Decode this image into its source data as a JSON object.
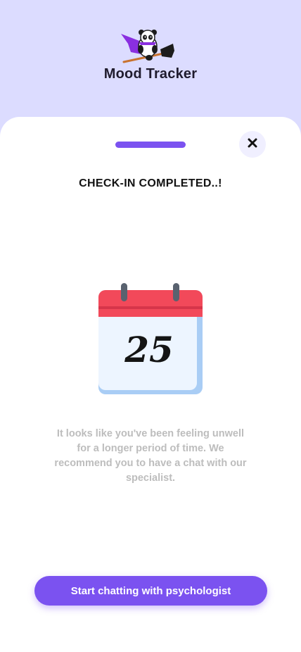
{
  "header": {
    "app_name": "Mood Tracker",
    "logo_icon": "panda-witch-on-broom-icon"
  },
  "sheet": {
    "heading": "CHECK-IN COMPLETED..!",
    "close_icon": "close-icon",
    "calendar": {
      "icon": "calendar-icon",
      "day": "25"
    },
    "message": "It looks like you've been feeling unwell for a longer period of time. We recommend you to have a chat with our specialist.",
    "cta_label": "Start chatting with psychologist"
  },
  "colors": {
    "background": "#dcdcff",
    "accent": "#7b52f0",
    "handle": "#7b52f0",
    "calendar_header": "#f2495a",
    "calendar_body": "#edf5ff"
  }
}
